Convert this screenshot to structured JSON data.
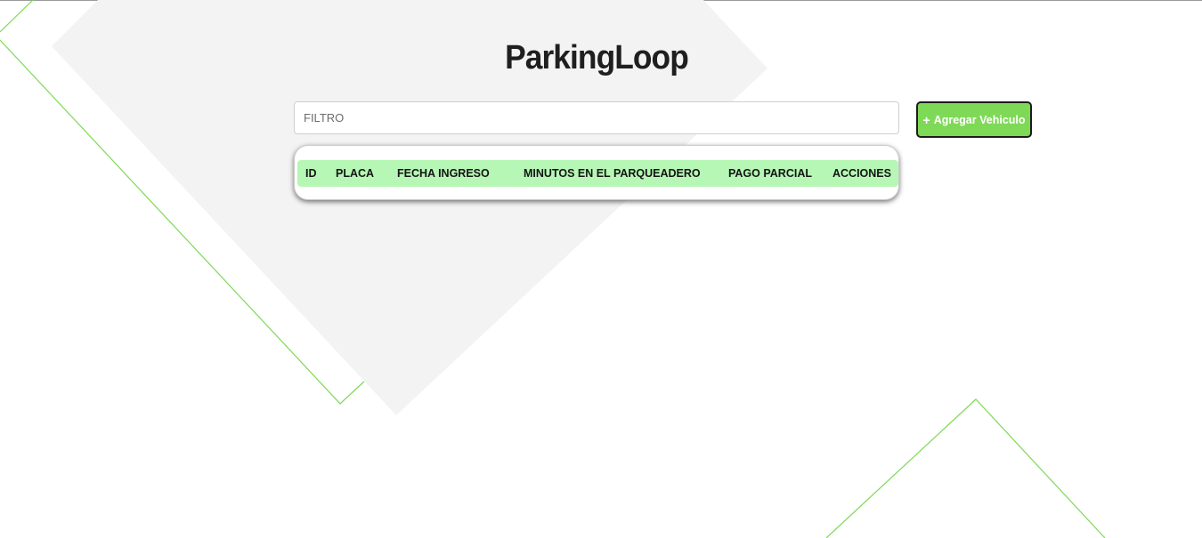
{
  "app": {
    "title": "ParkingLoop"
  },
  "filter": {
    "placeholder": "FILTRO",
    "value": ""
  },
  "actions": {
    "add_vehicle_label": "Agregar Vehiculo",
    "add_icon": "plus-icon"
  },
  "table": {
    "columns": [
      "ID",
      "PLACA",
      "FECHA INGRESO",
      "MINUTOS EN EL PARQUEADERO",
      "PAGO PARCIAL",
      "ACCIONES"
    ],
    "rows": []
  },
  "colors": {
    "accent_green": "#7ed957",
    "header_green": "#b6f7b6",
    "decor_line_green": "#7ed957",
    "decor_gray": "#f3f3f3"
  }
}
